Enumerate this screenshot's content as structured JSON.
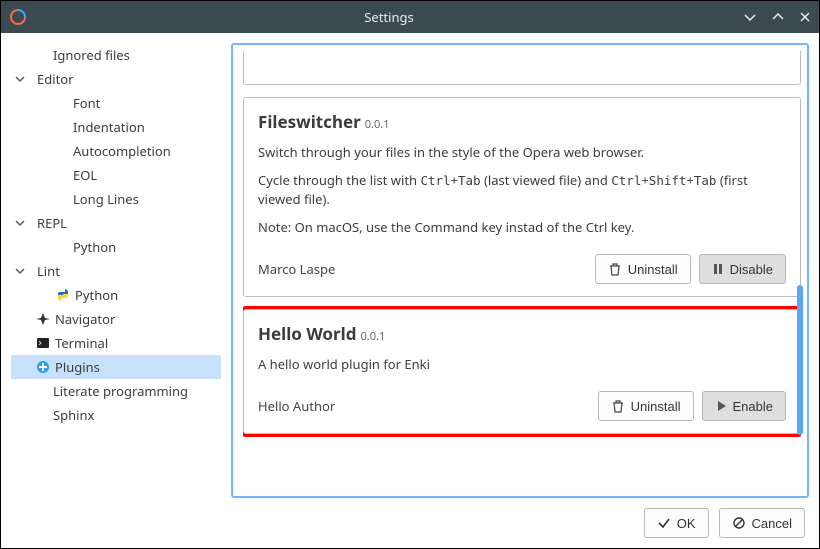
{
  "window": {
    "title": "Settings"
  },
  "sidebar": {
    "items": [
      {
        "label": "Ignored files",
        "depth": 1,
        "leaf": true,
        "expander": false
      },
      {
        "label": "Editor",
        "depth": 0,
        "leaf": false,
        "expander": true
      },
      {
        "label": "Font",
        "depth": 2,
        "leaf": true,
        "expander": false
      },
      {
        "label": "Indentation",
        "depth": 2,
        "leaf": true,
        "expander": false
      },
      {
        "label": "Autocompletion",
        "depth": 2,
        "leaf": true,
        "expander": false
      },
      {
        "label": "EOL",
        "depth": 2,
        "leaf": true,
        "expander": false
      },
      {
        "label": "Long Lines",
        "depth": 2,
        "leaf": true,
        "expander": false
      },
      {
        "label": "REPL",
        "depth": 0,
        "leaf": false,
        "expander": true
      },
      {
        "label": "Python",
        "depth": 2,
        "leaf": true,
        "expander": false
      },
      {
        "label": "Lint",
        "depth": 0,
        "leaf": false,
        "expander": true
      },
      {
        "label": "Python",
        "depth": 1,
        "leaf": true,
        "expander": false,
        "icon": "python"
      },
      {
        "label": "Navigator",
        "depth": 0,
        "leaf": true,
        "expander": false,
        "icon": "navigator"
      },
      {
        "label": "Terminal",
        "depth": 0,
        "leaf": true,
        "expander": false,
        "icon": "terminal"
      },
      {
        "label": "Plugins",
        "depth": 0,
        "leaf": true,
        "expander": false,
        "icon": "plugins",
        "selected": true
      },
      {
        "label": "Literate programming",
        "depth": 1,
        "leaf": true,
        "expander": false
      },
      {
        "label": "Sphinx",
        "depth": 1,
        "leaf": true,
        "expander": false
      }
    ]
  },
  "plugins": {
    "clipped_buttons": {
      "uninstall": "Uninstall",
      "disable": "Disable"
    },
    "cards": [
      {
        "name": "Fileswitcher",
        "version": "0.0.1",
        "desc_lines": [
          "Switch through your files in the style of the Opera web browser.",
          "Cycle through the list with <kbd>Ctrl</kbd>+<kbd>Tab</kbd> (last viewed file) and <kbd>Ctrl</kbd>+<kbd>Shift</kbd>+<kbd>Tab</kbd> (first viewed file).",
          "Note: On macOS, use the Command key instad of the Ctrl key."
        ],
        "author": "Marco Laspe",
        "uninstall": "Uninstall",
        "action": "Disable",
        "action_kind": "disable"
      },
      {
        "name": "Hello World",
        "version": "0.0.1",
        "desc_lines": [
          "A hello world plugin for Enki"
        ],
        "author": "Hello Author",
        "uninstall": "Uninstall",
        "action": "Enable",
        "action_kind": "enable",
        "highlight": true
      }
    ]
  },
  "buttons": {
    "ok": "OK",
    "cancel": "Cancel"
  }
}
